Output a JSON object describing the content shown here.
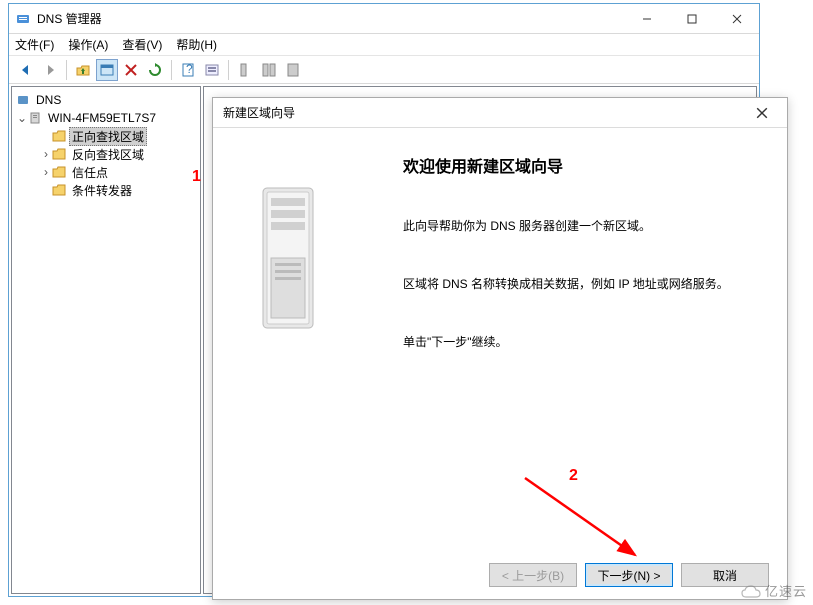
{
  "window": {
    "title": "DNS 管理器",
    "controls": {
      "min": "minimize",
      "max": "maximize",
      "close": "close"
    }
  },
  "menubar": {
    "file": "文件(F)",
    "action": "操作(A)",
    "view": "查看(V)",
    "help": "帮助(H)"
  },
  "tree": {
    "root": "DNS",
    "server": "WIN-4FM59ETL7S7",
    "items": [
      "正向查找区域",
      "反向查找区域",
      "信任点",
      "条件转发器"
    ]
  },
  "wizard": {
    "title": "新建区域向导",
    "heading": "欢迎使用新建区域向导",
    "p1": "此向导帮助你为 DNS 服务器创建一个新区域。",
    "p2": "区域将 DNS 名称转换成相关数据，例如 IP 地址或网络服务。",
    "p3": "单击\"下一步\"继续。",
    "buttons": {
      "back": "< 上一步(B)",
      "next": "下一步(N) >",
      "cancel": "取消"
    }
  },
  "annotations": {
    "one": "1",
    "two": "2"
  },
  "watermark": "亿速云"
}
